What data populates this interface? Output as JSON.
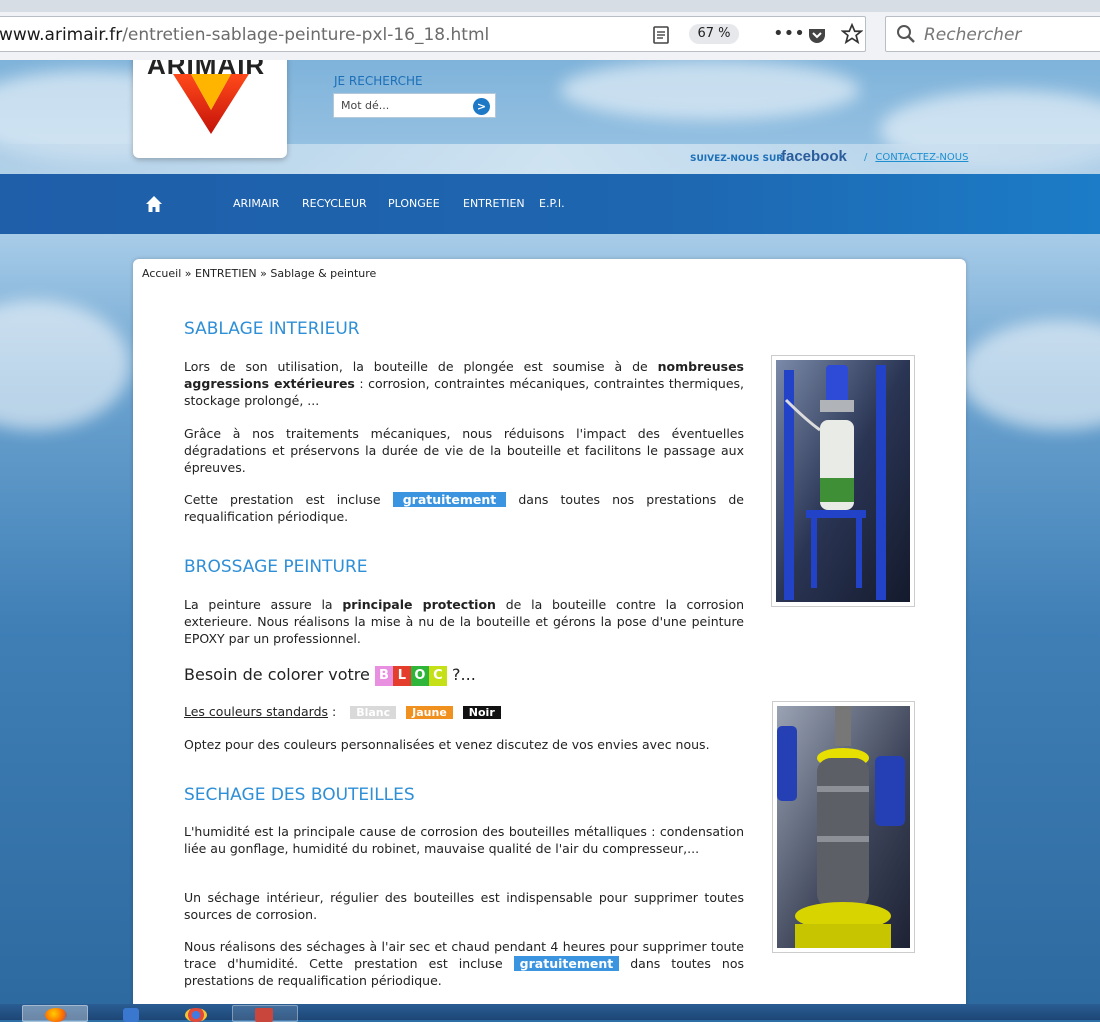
{
  "browser": {
    "url_host": "www.arimair.fr",
    "url_path": "/entretien-sablage-peinture-pxl-16_18.html",
    "zoom": "67 %",
    "more": "•••",
    "search_placeholder": "Rechercher"
  },
  "header": {
    "logo_text": "ARIMAIR",
    "search_label": "JE RECHERCHE",
    "search_placeholder": "Mot dé...",
    "search_go": ">",
    "follow_label": "SUIVEZ-NOUS SUR",
    "facebook": "facebook",
    "separator": "/",
    "contact": "CONTACTEZ-NOUS"
  },
  "nav": {
    "items": [
      "ARIMAIR",
      "RECYCLEUR",
      "PLONGEE",
      "ENTRETIEN",
      "E.P.I."
    ]
  },
  "breadcrumb": "Accueil » ENTRETIEN » Sablage & peinture",
  "sections": {
    "sablage": {
      "title": "SABLAGE INTERIEUR",
      "p1_a": "Lors de son utilisation, la bouteille de plongée est soumise à de ",
      "p1_b": "nombreuses aggressions extérieures",
      "p1_c": " : corrosion, contraintes mécaniques, contraintes thermiques, stockage prolongé, ...",
      "p2": "Grâce à nos traitements mécaniques, nous réduisons l'impact des éventuelles dégradations et préservons la durée de vie de la bouteille et facilitons le passage aux épreuves.",
      "p3_a": "Cette prestation est incluse ",
      "p3_b": "gratuitement",
      "p3_c": " dans toutes nos prestations de requalification périodique."
    },
    "brossage": {
      "title": "BROSSAGE PEINTURE",
      "p1_a": "La peinture assure la ",
      "p1_b": "principale protection",
      "p1_c": " de la bouteille contre la corrosion exterieure. Nous réalisons la mise à nu de la bouteille et gérons la pose d'une peinture EPOXY par un professionnel.",
      "besoin_a": "Besoin de colorer votre ",
      "bloc_letters": [
        "B",
        "L",
        "O",
        "C"
      ],
      "bloc_colors": [
        "#e98fe0",
        "#e43d2c",
        "#2fb53a",
        "#c6e018"
      ],
      "besoin_b": " ?...",
      "colors_label": "Les couleurs standards",
      "colors_sep": " :",
      "swatches": [
        {
          "label": "Blanc",
          "bg": "#d9d9d9",
          "fg": "#ffffff"
        },
        {
          "label": "Jaune",
          "bg": "#f0901e",
          "fg": "#ffffff"
        },
        {
          "label": "Noir",
          "bg": "#111111",
          "fg": "#ffffff"
        }
      ],
      "p2": "Optez pour des couleurs personnalisées et venez discutez de vos envies avec nous."
    },
    "sechage": {
      "title": "SECHAGE DES BOUTEILLES",
      "p1": "L'humidité est la principale cause de corrosion des bouteilles métalliques : condensation liée au gonflage, humidité du robinet, mauvaise qualité de l'air du compresseur,...",
      "p2": "Un séchage intérieur, régulier des bouteilles est indispensable pour supprimer toutes sources de corrosion.",
      "p3_a": "Nous réalisons des séchages à l'air sec et chaud pendant 4 heures pour supprimer toute trace d'humidité. Cette prestation est incluse ",
      "p3_b": "gratuitement",
      "p3_c": " dans toutes nos prestations de requalification périodique."
    }
  },
  "colors": {
    "accent": "#2f8fd6",
    "nav": "#1f5ea9",
    "highlight": "#3a94e0"
  }
}
